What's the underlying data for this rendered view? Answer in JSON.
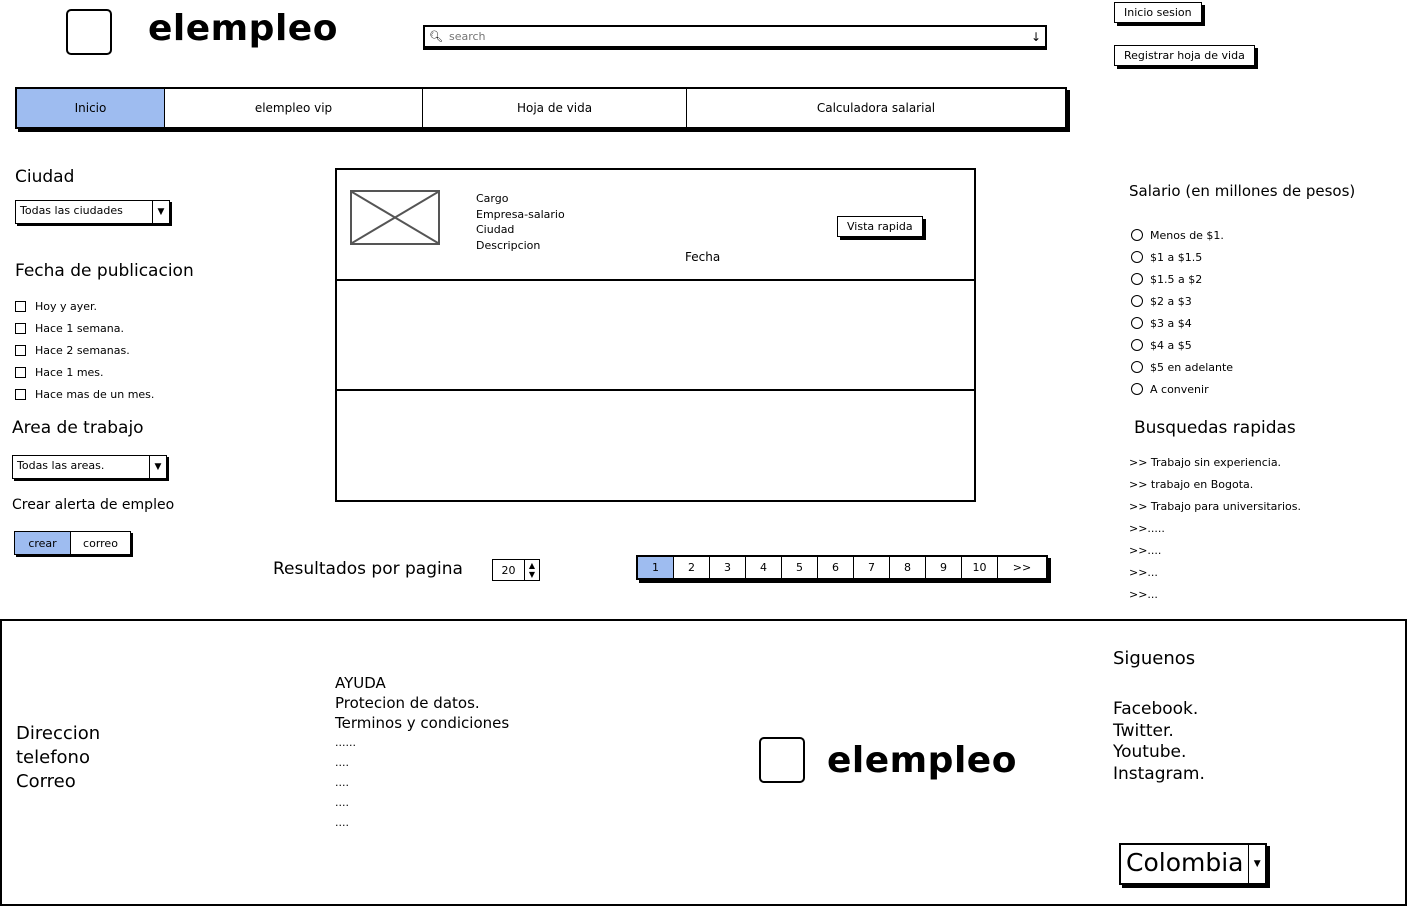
{
  "header": {
    "logo_text": "elempleo",
    "search_placeholder": "search",
    "login_label": "Inicio sesion",
    "register_label": "Registrar hoja de vida"
  },
  "nav": {
    "tabs": [
      "Inicio",
      "elempleo vip",
      "Hoja de vida",
      "Calculadora salarial"
    ]
  },
  "filters": {
    "city_title": "Ciudad",
    "city_value": "Todas las ciudades",
    "date_title": "Fecha de publicacion",
    "date_options": [
      "Hoy y ayer.",
      "Hace 1 semana.",
      "Hace 2 semanas.",
      "Hace 1 mes.",
      "Hace mas de un mes."
    ],
    "area_title": "Area de trabajo",
    "area_value": "Todas las areas.",
    "alert_title": "Crear alerta de empleo",
    "alert_create": "crear",
    "alert_email": "correo"
  },
  "result": {
    "cargo": "Cargo",
    "empresa": "Empresa-salario",
    "ciudad": "Ciudad",
    "descripcion": "Descripcion",
    "fecha": "Fecha",
    "quick_view": "Vista rapida"
  },
  "pagination": {
    "per_page_label": "Resultados por pagina",
    "per_page_value": "20",
    "pages": [
      "1",
      "2",
      "3",
      "4",
      "5",
      "6",
      "7",
      "8",
      "9",
      "10",
      ">>"
    ],
    "active_page": "1"
  },
  "salary": {
    "title": "Salario (en millones de pesos)",
    "options": [
      "Menos de $1.",
      "$1 a $1.5",
      "$1.5 a $2",
      "$2 a $3",
      "$3 a $4",
      "$4 a $5",
      "$5 en adelante",
      "A convenir"
    ]
  },
  "quick": {
    "title": "Busquedas rapidas",
    "links": [
      ">> Trabajo sin experiencia.",
      ">> trabajo en Bogota.",
      ">> Trabajo para universitarios.",
      ">>.....",
      ">>....",
      ">>...",
      ">>..."
    ]
  },
  "footer": {
    "contact": [
      "Direccion",
      "telefono",
      "Correo"
    ],
    "help_links": [
      "AYUDA",
      "Protecion de datos.",
      "Terminos y condiciones",
      "......",
      "....",
      "....",
      "....",
      "...."
    ],
    "logo_text": "elempleo",
    "follow_title": "Siguenos",
    "social": [
      "Facebook.",
      "Twitter.",
      "Youtube.",
      "Instagram."
    ],
    "country": "Colombia"
  },
  "colors": {
    "accent": "#9ebcf0"
  }
}
